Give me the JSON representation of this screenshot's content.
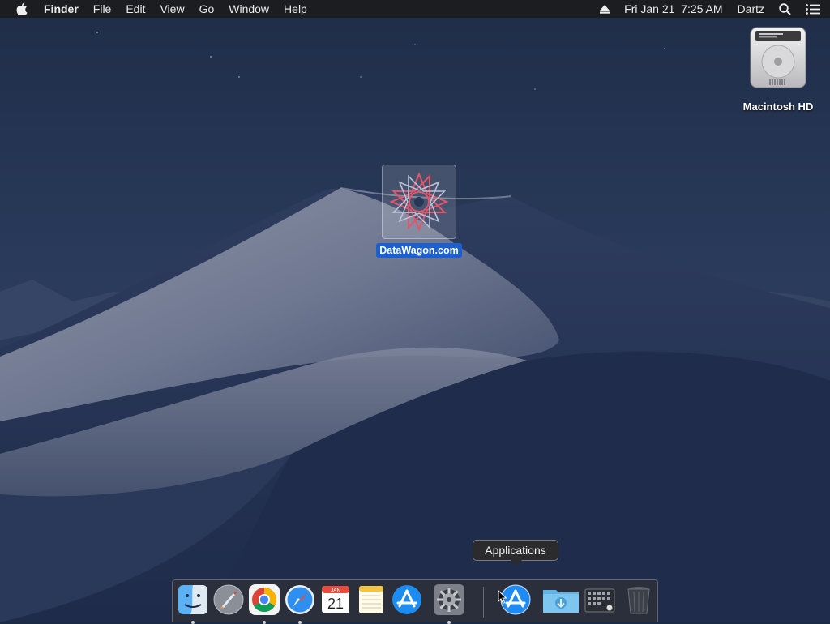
{
  "menubar": {
    "app_name": "Finder",
    "menus": [
      "File",
      "Edit",
      "View",
      "Go",
      "Window",
      "Help"
    ],
    "clock": "Fri Jan 21  7:25 AM",
    "user": "Dartz"
  },
  "desktop": {
    "hd_label": "Macintosh HD",
    "file_label": "DataWagon.com"
  },
  "tooltip": {
    "text": "Applications"
  },
  "dock": {
    "calendar_month": "JAN",
    "calendar_day": "21"
  },
  "icons": {
    "apple": "apple-icon",
    "eject": "eject-icon",
    "spotlight": "magnifier-icon",
    "notification": "list-icon"
  },
  "colors": {
    "selection": "#1d5fce",
    "menubar": "#1c1c1e"
  }
}
